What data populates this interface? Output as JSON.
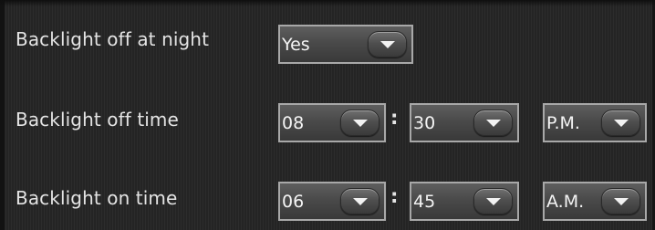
{
  "rows": [
    {
      "label": "Backlight off at night",
      "controls": [
        {
          "value": "Yes"
        }
      ]
    },
    {
      "label": "Backlight off time",
      "controls": [
        {
          "value": "08"
        },
        {
          "value": "30"
        },
        {
          "value": "P.M."
        }
      ],
      "separator": ":"
    },
    {
      "label": "Backlight on time",
      "controls": [
        {
          "value": "06"
        },
        {
          "value": "45"
        },
        {
          "value": "A.M."
        }
      ],
      "separator": ":"
    }
  ],
  "colors": {
    "background": "#242424",
    "label_text": "#e4e4e4",
    "dropdown_border": "#a8a8a8",
    "dropdown_value": "#f4f4f4"
  },
  "icons": {
    "dropdown_arrow": "chevron-down-icon"
  }
}
